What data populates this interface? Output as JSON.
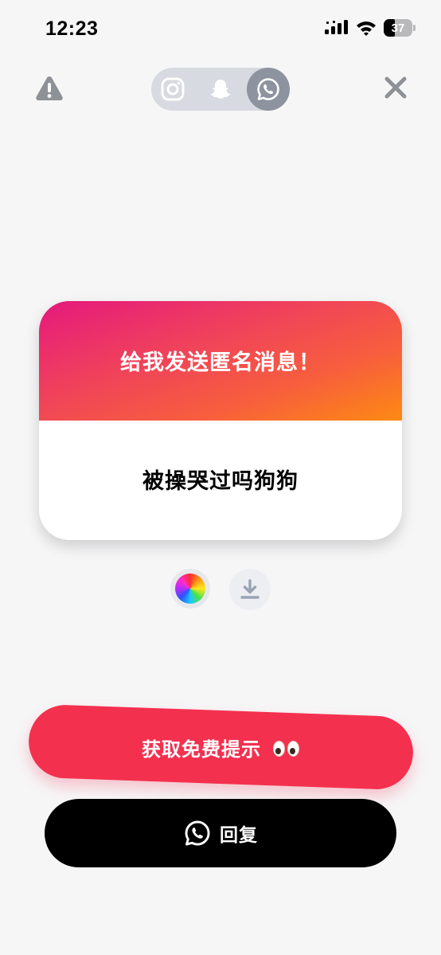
{
  "status_bar": {
    "time": "12:23",
    "battery": "37"
  },
  "platforms": [
    {
      "name": "instagram",
      "icon": "instagram-icon",
      "selected": false
    },
    {
      "name": "snapchat",
      "icon": "snapchat-icon",
      "selected": false
    },
    {
      "name": "whatsapp",
      "icon": "whatsapp-icon",
      "selected": true
    }
  ],
  "card": {
    "title": "给我发送匿名消息！",
    "message": "被操哭过吗狗狗",
    "gradient": [
      "#e5197d",
      "#fd8a12"
    ]
  },
  "tools": {
    "color_icon": "color-wheel-icon",
    "download_icon": "download-icon"
  },
  "buttons": {
    "hint_label": "获取免费提示",
    "hint_emoji": "eyes-emoji",
    "reply_label": "回复",
    "hint_color": "#f4304f",
    "reply_color": "#000000"
  }
}
